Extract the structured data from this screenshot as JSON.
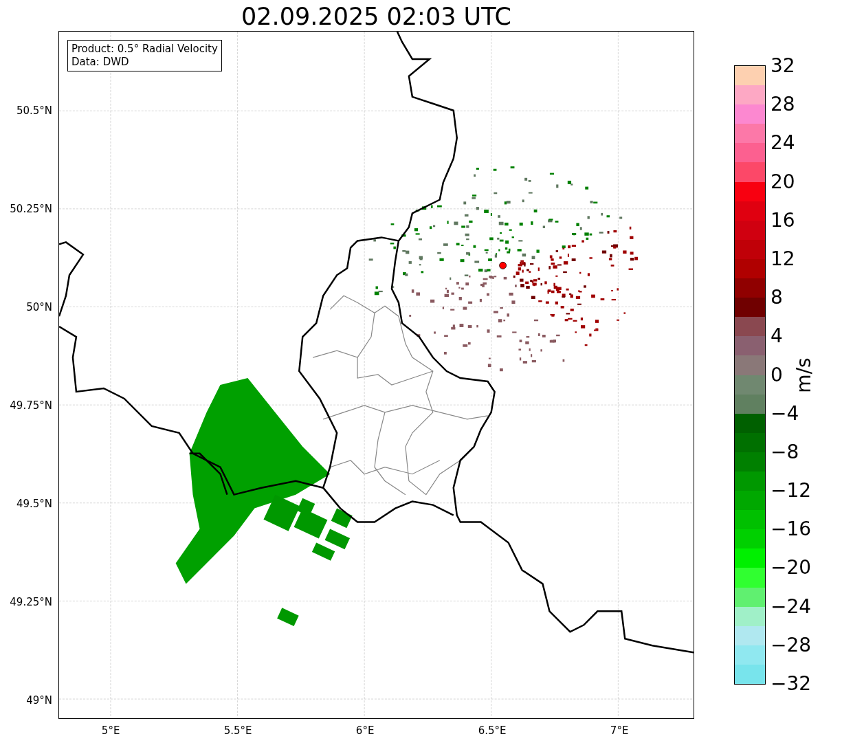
{
  "title": "02.09.2025 02:03 UTC",
  "legend": [
    "Product: 0.5° Radial Velocity",
    "Data: DWD"
  ],
  "x_ticks": [
    "5°E",
    "5.5°E",
    "6°E",
    "6.5°E",
    "7°E"
  ],
  "y_ticks": [
    "50.5°N",
    "50.25°N",
    "50°N",
    "49.75°N",
    "49.5°N",
    "49.25°N",
    "49°N"
  ],
  "colorbar": {
    "label": "m/s",
    "ticks": [
      "32",
      "28",
      "24",
      "20",
      "16",
      "12",
      "8",
      "4",
      "0",
      "−4",
      "−8",
      "−12",
      "−16",
      "−20",
      "−24",
      "−28",
      "−32"
    ],
    "bands": [
      {
        "color": "#fdd0b0"
      },
      {
        "color": "#fda8c4"
      },
      {
        "color": "#fc88d0"
      },
      {
        "color": "#fc78a8"
      },
      {
        "color": "#fc6090"
      },
      {
        "color": "#fc4868"
      },
      {
        "color": "#f80010"
      },
      {
        "color": "#e00010"
      },
      {
        "color": "#d00010"
      },
      {
        "color": "#c00008"
      },
      {
        "color": "#b00000"
      },
      {
        "color": "#900000"
      },
      {
        "color": "#700000"
      },
      {
        "color": "#8a4850"
      },
      {
        "color": "#8a6070"
      },
      {
        "color": "#8a7878"
      },
      {
        "color": "#708870"
      },
      {
        "color": "#608060"
      },
      {
        "color": "#006000"
      },
      {
        "color": "#007000"
      },
      {
        "color": "#008000"
      },
      {
        "color": "#009800"
      },
      {
        "color": "#00a800"
      },
      {
        "color": "#00c000"
      },
      {
        "color": "#00d000"
      },
      {
        "color": "#00f000"
      },
      {
        "color": "#30ff30"
      },
      {
        "color": "#60f070"
      },
      {
        "color": "#a0f0c8"
      },
      {
        "color": "#b0e8f0"
      },
      {
        "color": "#90e8f0"
      },
      {
        "color": "#78e4ec"
      }
    ]
  }
}
